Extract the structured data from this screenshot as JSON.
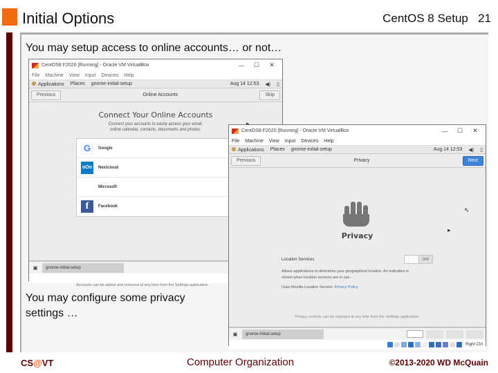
{
  "slide": {
    "title": "Initial Options",
    "header_right": "CentOS 8 Setup",
    "page_number": "21",
    "caption_top": "You may setup access to online accounts… or not…",
    "caption_bottom": "You may configure some privacy settings …",
    "accent_color": "#f26b10",
    "bar_color": "#5c0000"
  },
  "footer": {
    "left_prefix": "CS",
    "left_at": "@",
    "left_suffix": "VT",
    "center": "Computer Organization",
    "right": "©2013-2020 WD McQuain"
  },
  "vm_online_accounts": {
    "window_title": "CentOS8 F2020 [Running] - Oracle VM VirtualBox",
    "controls": {
      "minimize": "—",
      "maximize": "☐",
      "close": "✕"
    },
    "menu": [
      "File",
      "Machine",
      "View",
      "Input",
      "Devices",
      "Help"
    ],
    "gnome_bar": {
      "applications": "Applications",
      "places": "Places",
      "app_name": "gnome-initial-setup",
      "clock": "Aug 14 12:53"
    },
    "header": {
      "previous": "Previous",
      "title": "Online Accounts",
      "skip": "Skip"
    },
    "heading": "Connect Your Online Accounts",
    "subtitle_line1": "Connect your accounts to easily access your email,",
    "subtitle_line2": "online calendar, contacts, documents and photos.",
    "accounts": [
      {
        "name": "Google",
        "icon": "google-icon"
      },
      {
        "name": "Nextcloud",
        "icon": "nextcloud-icon"
      },
      {
        "name": "Microsoft",
        "icon": "microsoft-icon"
      },
      {
        "name": "Facebook",
        "icon": "facebook-icon"
      }
    ],
    "footer_note": "Accounts can be added and removed at any time from the Settings application.",
    "taskbar_item": "gnome-initial-setup"
  },
  "vm_privacy": {
    "window_title": "CentOS8 F2020 [Running] - Oracle VM VirtualBox",
    "controls": {
      "minimize": "—",
      "maximize": "☐",
      "close": "✕"
    },
    "menu": [
      "File",
      "Machine",
      "View",
      "Input",
      "Devices",
      "Help"
    ],
    "gnome_bar": {
      "applications": "Applications",
      "places": "Places",
      "app_name": "gnome-initial-setup",
      "clock": "Aug 14 12:53"
    },
    "header": {
      "previous": "Previous",
      "title": "Privacy",
      "next": "Next"
    },
    "heading": "Privacy",
    "location_label": "Location Services",
    "location_toggle": "OFF",
    "location_desc": "Allows applications to determine your geographical location. An indication is shown when location services are in use.",
    "mozilla_prefix": "Uses Mozilla Location Service:",
    "privacy_policy_link": "Privacy Policy",
    "footer_note": "Privacy controls can be changed at any time from the Settings application.",
    "taskbar_item": "gnome-initial-setup",
    "host_key": "Right Ctrl"
  }
}
